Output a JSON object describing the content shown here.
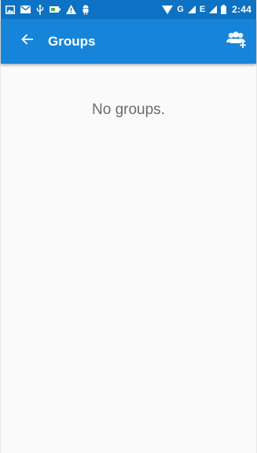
{
  "status_bar": {
    "time": "2:44",
    "network_label": "G",
    "network_label_2": "E",
    "icons": [
      "image-icon",
      "mail-icon",
      "usb-icon",
      "battery-saver-icon",
      "warning-icon",
      "android-icon",
      "wifi-icon",
      "signal-icon",
      "battery-icon"
    ]
  },
  "app_bar": {
    "title": "Groups",
    "back_icon": "arrow-back-icon",
    "action_icon": "add-group-icon"
  },
  "content": {
    "empty_message": "No groups."
  },
  "colors": {
    "status_bar": "#0d72c4",
    "app_bar": "#1584d9",
    "background": "#fafafa",
    "empty_text": "#6b6b6b"
  }
}
